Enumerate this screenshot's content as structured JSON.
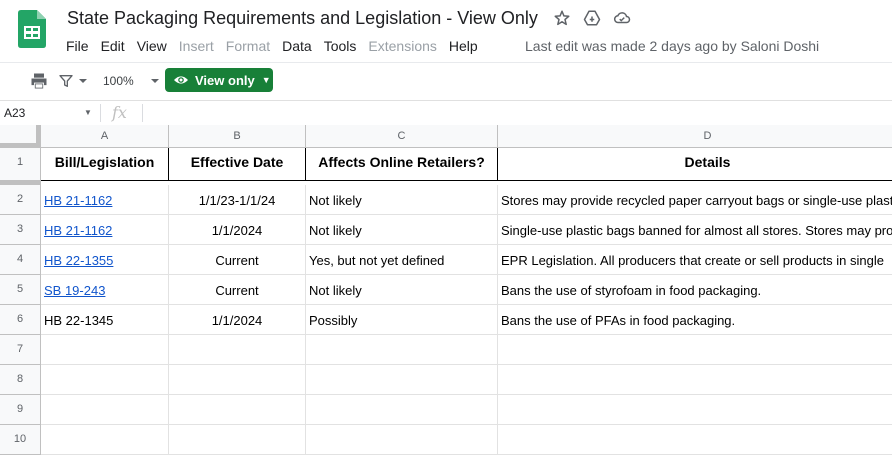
{
  "app": {
    "title": "State Packaging Requirements and Legislation - View Only",
    "last_edit": "Last edit was made 2 days ago by Saloni Doshi",
    "icons": [
      "star-icon",
      "move-to-drive-icon",
      "cloud-status-icon"
    ]
  },
  "menu": [
    {
      "label": "File",
      "disabled": false
    },
    {
      "label": "Edit",
      "disabled": false
    },
    {
      "label": "View",
      "disabled": false
    },
    {
      "label": "Insert",
      "disabled": true
    },
    {
      "label": "Format",
      "disabled": true
    },
    {
      "label": "Data",
      "disabled": false
    },
    {
      "label": "Tools",
      "disabled": false
    },
    {
      "label": "Extensions",
      "disabled": true
    },
    {
      "label": "Help",
      "disabled": false
    }
  ],
  "toolbar": {
    "zoom": "100%",
    "view_only_label": "View only"
  },
  "formula_bar": {
    "cell_ref": "A23",
    "fx": "fx"
  },
  "colors": {
    "brand_green": "#188038",
    "link_blue": "#1155cc",
    "disabled_gray": "#9aa0a6"
  },
  "columns": [
    "A",
    "B",
    "C",
    "D"
  ],
  "rows": [
    {
      "num": "1",
      "cells": [
        "Bill/Legislation",
        "Effective Date",
        "Affects Online Retailers?",
        "Details"
      ]
    },
    {
      "num": "2",
      "cells": [
        "HB 21-1162",
        "1/1/23-1/1/24",
        "Not likely",
        "Stores may provide recycled paper carryout bags or single-use plastic"
      ],
      "link": true
    },
    {
      "num": "3",
      "cells": [
        "HB 21-1162",
        "1/1/2024",
        "Not likely",
        "Single-use plastic bags banned for almost all stores. Stores may provide"
      ],
      "link": true
    },
    {
      "num": "4",
      "cells": [
        "HB 22-1355",
        "Current",
        "Yes, but not yet defined",
        "EPR Legislation. All producers that create or sell products in single"
      ],
      "link": true
    },
    {
      "num": "5",
      "cells": [
        "SB 19-243",
        "Current",
        "Not likely",
        "Bans the use of styrofoam in food packaging."
      ],
      "link": true
    },
    {
      "num": "6",
      "cells": [
        "HB 22-1345",
        "1/1/2024",
        "Possibly",
        "Bans the use of PFAs in food packaging."
      ],
      "link": false
    },
    {
      "num": "7",
      "cells": [
        "",
        "",
        "",
        ""
      ]
    },
    {
      "num": "8",
      "cells": [
        "",
        "",
        "",
        ""
      ]
    },
    {
      "num": "9",
      "cells": [
        "",
        "",
        "",
        ""
      ]
    },
    {
      "num": "10",
      "cells": [
        "",
        "",
        "",
        ""
      ]
    }
  ]
}
